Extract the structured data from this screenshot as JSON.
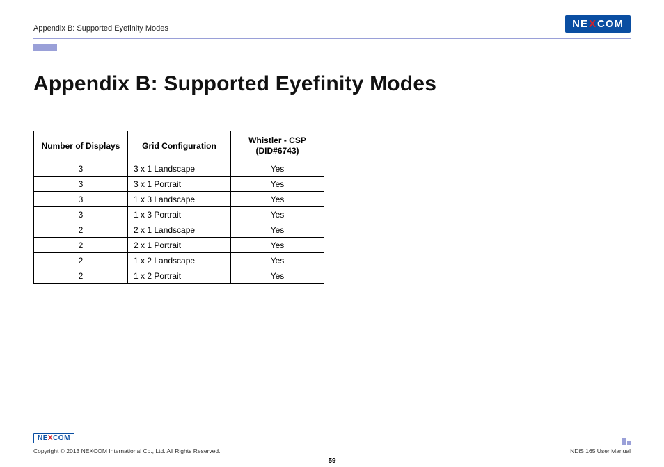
{
  "header": {
    "running_head": "Appendix B: Supported Eyefinity Modes",
    "logo": {
      "pre": "NE",
      "x": "X",
      "post": "COM"
    }
  },
  "title": "Appendix B: Supported Eyefinity Modes",
  "table": {
    "headers": {
      "col0": "Number of Displays",
      "col1": "Grid Configuration",
      "col2_line1": "Whistler - CSP",
      "col2_line2": "(DID#6743)"
    },
    "rows": [
      {
        "num": "3",
        "grid": "3 x 1 Landscape",
        "csp": "Yes"
      },
      {
        "num": "3",
        "grid": "3 x 1 Portrait",
        "csp": "Yes"
      },
      {
        "num": "3",
        "grid": "1 x 3 Landscape",
        "csp": "Yes"
      },
      {
        "num": "3",
        "grid": "1 x 3 Portrait",
        "csp": "Yes"
      },
      {
        "num": "2",
        "grid": "2 x 1 Landscape",
        "csp": "Yes"
      },
      {
        "num": "2",
        "grid": "2 x 1 Portrait",
        "csp": "Yes"
      },
      {
        "num": "2",
        "grid": "1 x 2 Landscape",
        "csp": "Yes"
      },
      {
        "num": "2",
        "grid": "1 x 2 Portrait",
        "csp": "Yes"
      }
    ]
  },
  "footer": {
    "logo": {
      "pre": "NE",
      "x": "X",
      "post": "COM"
    },
    "copyright": "Copyright © 2013 NEXCOM International Co., Ltd. All Rights Reserved.",
    "page": "59",
    "manual": "NDiS 165 User Manual"
  }
}
